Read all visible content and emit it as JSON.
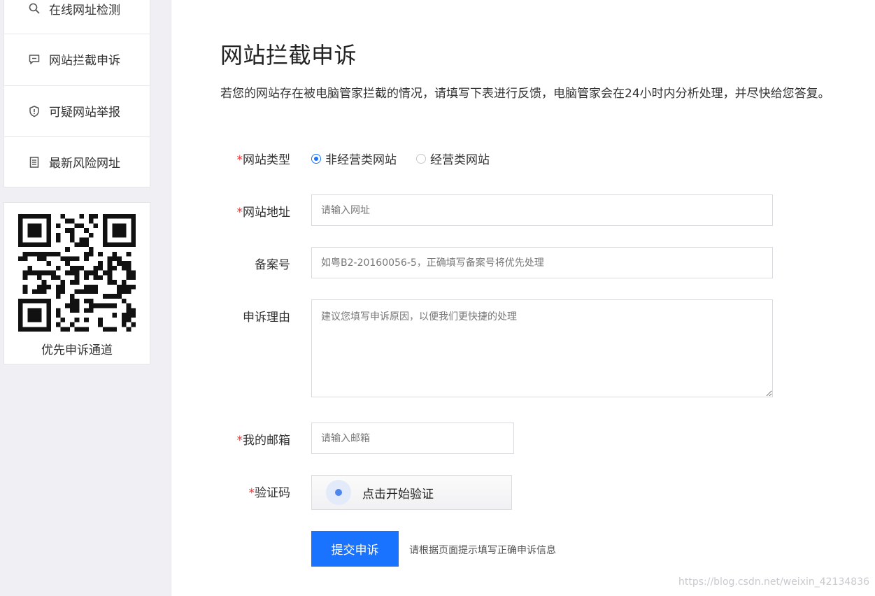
{
  "sidebar": {
    "items": [
      {
        "label": "在线网址检测",
        "icon": "search-icon"
      },
      {
        "label": "网站拦截申诉",
        "icon": "chat-icon"
      },
      {
        "label": "可疑网站举报",
        "icon": "shield-icon"
      },
      {
        "label": "最新风险网址",
        "icon": "document-icon"
      }
    ],
    "qr_caption": "优先申诉通道"
  },
  "main": {
    "title": "网站拦截申诉",
    "description": "若您的网站存在被电脑管家拦截的情况，请填写下表进行反馈，电脑管家会在24小时内分析处理，并尽快给您答复。"
  },
  "form": {
    "required_mark": "*",
    "site_type": {
      "label": "网站类型",
      "options": [
        "非经营类网站",
        "经营类网站"
      ],
      "selected": "非经营类网站"
    },
    "site_url": {
      "label": "网站地址",
      "placeholder": "请输入网址",
      "value": ""
    },
    "icp": {
      "label": "备案号",
      "placeholder": "如粤B2-20160056-5，正确填写备案号将优先处理",
      "value": ""
    },
    "reason": {
      "label": "申诉理由",
      "placeholder": "建议您填写申诉原因，以便我们更快捷的处理",
      "value": ""
    },
    "email": {
      "label": "我的邮箱",
      "placeholder": "请输入邮箱",
      "value": ""
    },
    "captcha": {
      "label": "验证码",
      "button_text": "点击开始验证"
    },
    "submit_label": "提交申诉",
    "submit_hint": "请根据页面提示填写正确申诉信息"
  },
  "watermark": "https://blog.csdn.net/weixin_42134836",
  "colors": {
    "accent": "#1a73ff",
    "required": "#e33333",
    "sidebar_bg": "#efeff4"
  }
}
